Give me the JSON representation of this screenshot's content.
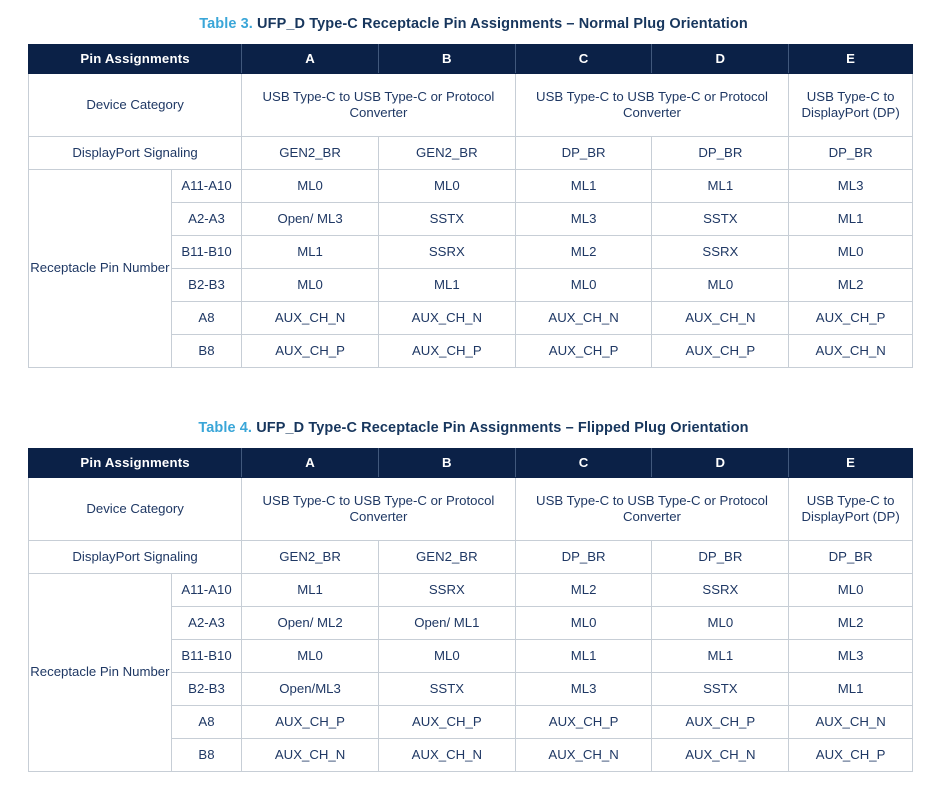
{
  "document": {
    "accent_color": "#3aa6d8",
    "header_bg_color": "#0b2147",
    "text_color": "#1f3864",
    "border_color": "#c7ced6"
  },
  "tables": [
    {
      "caption_number": "Table 3.",
      "caption_title": "UFP_D Type-C Receptacle Pin Assignments – Normal Plug Orientation",
      "columns": [
        "Pin Assignments",
        "A",
        "B",
        "C",
        "D",
        "E"
      ],
      "device_category_label": "Device Category",
      "device_category_values": [
        "USB Type-C to USB Type-C or Protocol Converter",
        "USB Type-C to USB Type-C or Protocol Converter",
        "USB Type-C to DisplayPort (DP)"
      ],
      "signaling_label": "DisplayPort Signaling",
      "signaling_values": [
        "GEN2_BR",
        "GEN2_BR",
        "DP_BR",
        "DP_BR",
        "DP_BR"
      ],
      "pin_group_label": "Receptacle Pin Number",
      "pin_rows": [
        {
          "pin": "A11-A10",
          "values": [
            "ML0",
            "ML0",
            "ML1",
            "ML1",
            "ML3"
          ]
        },
        {
          "pin": "A2-A3",
          "values": [
            "Open/ ML3",
            "SSTX",
            "ML3",
            "SSTX",
            "ML1"
          ]
        },
        {
          "pin": "B11-B10",
          "values": [
            "ML1",
            "SSRX",
            "ML2",
            "SSRX",
            "ML0"
          ]
        },
        {
          "pin": "B2-B3",
          "values": [
            "ML0",
            "ML1",
            "ML0",
            "ML0",
            "ML2"
          ]
        },
        {
          "pin": "A8",
          "values": [
            "AUX_CH_N",
            "AUX_CH_N",
            "AUX_CH_N",
            "AUX_CH_N",
            "AUX_CH_P"
          ]
        },
        {
          "pin": "B8",
          "values": [
            "AUX_CH_P",
            "AUX_CH_P",
            "AUX_CH_P",
            "AUX_CH_P",
            "AUX_CH_N"
          ]
        }
      ]
    },
    {
      "caption_number": "Table 4.",
      "caption_title": "UFP_D Type-C Receptacle Pin Assignments – Flipped Plug Orientation",
      "columns": [
        "Pin Assignments",
        "A",
        "B",
        "C",
        "D",
        "E"
      ],
      "device_category_label": "Device Category",
      "device_category_values": [
        "USB Type-C to USB Type-C or Protocol Converter",
        "USB Type-C to USB Type-C or Protocol Converter",
        "USB Type-C to DisplayPort (DP)"
      ],
      "signaling_label": "DisplayPort Signaling",
      "signaling_values": [
        "GEN2_BR",
        "GEN2_BR",
        "DP_BR",
        "DP_BR",
        "DP_BR"
      ],
      "pin_group_label": "Receptacle Pin Number",
      "pin_rows": [
        {
          "pin": "A11-A10",
          "values": [
            "ML1",
            "SSRX",
            "ML2",
            "SSRX",
            "ML0"
          ]
        },
        {
          "pin": "A2-A3",
          "values": [
            "Open/ ML2",
            "Open/ ML1",
            "ML0",
            "ML0",
            "ML2"
          ]
        },
        {
          "pin": "B11-B10",
          "values": [
            "ML0",
            "ML0",
            "ML1",
            "ML1",
            "ML3"
          ]
        },
        {
          "pin": "B2-B3",
          "values": [
            "Open/ML3",
            "SSTX",
            "ML3",
            "SSTX",
            "ML1"
          ]
        },
        {
          "pin": "A8",
          "values": [
            "AUX_CH_P",
            "AUX_CH_P",
            "AUX_CH_P",
            "AUX_CH_P",
            "AUX_CH_N"
          ]
        },
        {
          "pin": "B8",
          "values": [
            "AUX_CH_N",
            "AUX_CH_N",
            "AUX_CH_N",
            "AUX_CH_N",
            "AUX_CH_P"
          ]
        }
      ]
    }
  ]
}
